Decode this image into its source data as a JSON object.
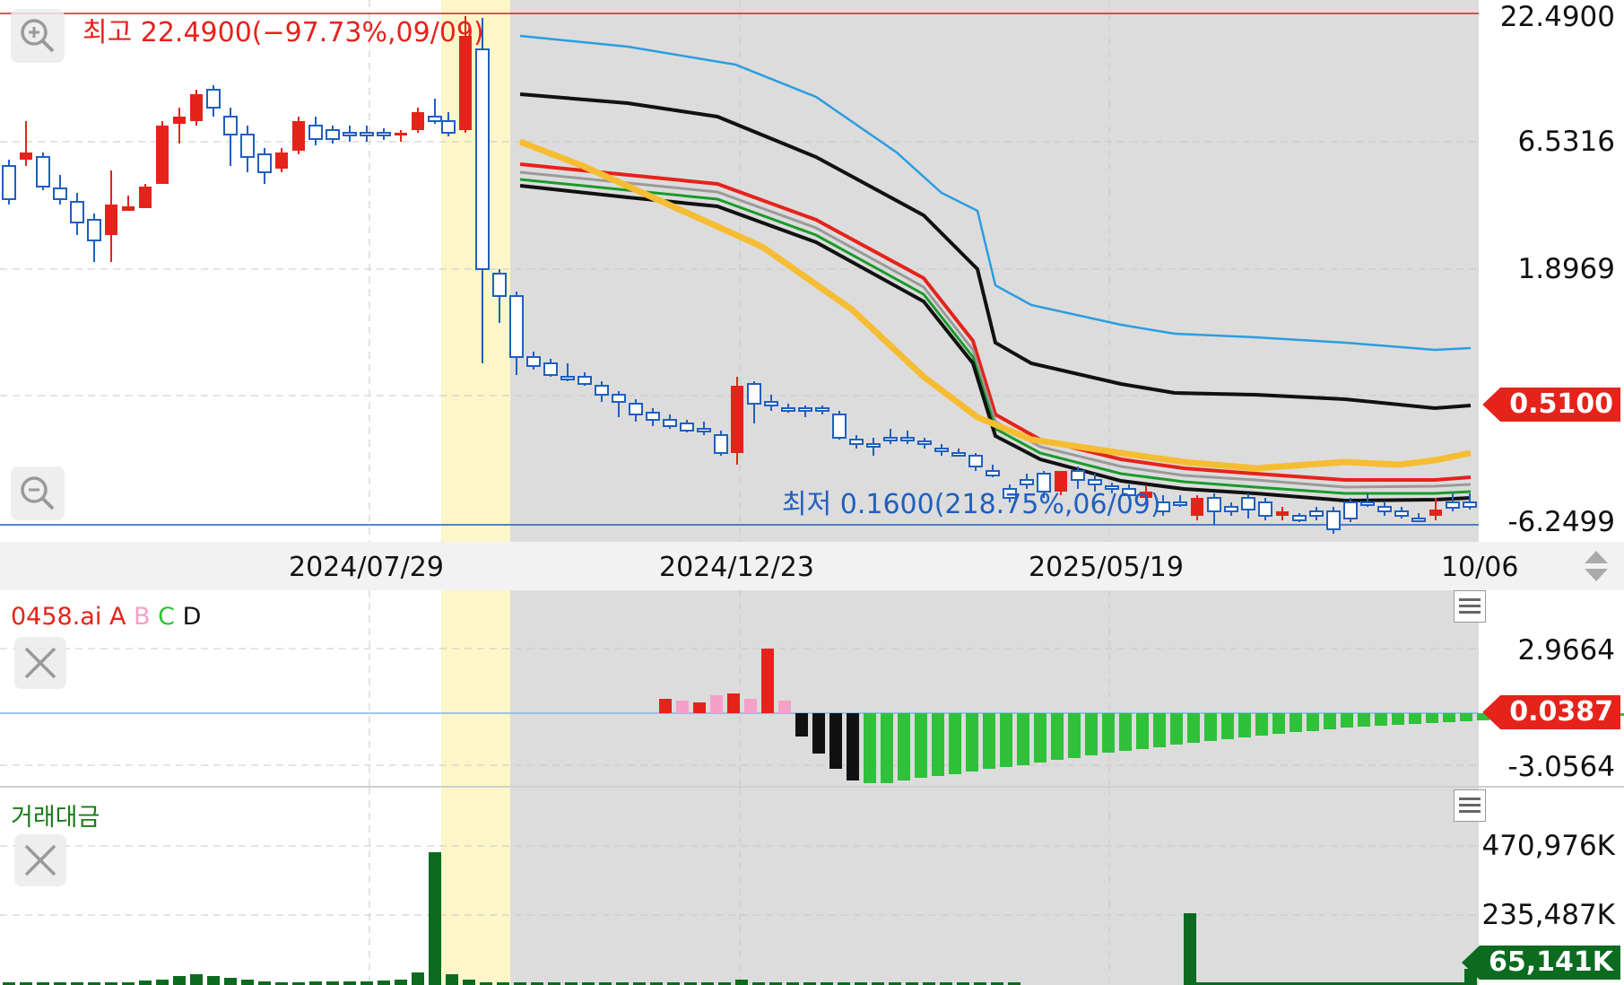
{
  "price_chart": {
    "high_label": "최고 22.4900(−97.73%,09/09)",
    "low_label": "최저 0.1600(218.75%,06/09)",
    "axis_labels": [
      "22.4900",
      "6.5316",
      "1.8969",
      "0.5100",
      "-6.2499"
    ],
    "current_price_badge": "0.5100"
  },
  "date_axis": {
    "labels": [
      "2024/07/29",
      "2024/12/23",
      "2025/05/19",
      "10/06"
    ]
  },
  "indicator_panel": {
    "title": "0458.ai",
    "legend": [
      {
        "key": "A",
        "color": "#e5231b"
      },
      {
        "key": "B",
        "color": "#f4a0c8"
      },
      {
        "key": "C",
        "color": "#2fc13a"
      },
      {
        "key": "D",
        "color": "#111111"
      }
    ],
    "axis_labels": [
      "2.9664",
      "-3.0564"
    ],
    "current_value_badge": "0.0387"
  },
  "volume_panel": {
    "title": "거래대금",
    "axis_labels": [
      "470,976K",
      "235,487K"
    ],
    "current_value_badge": "65,141K"
  },
  "icons": {
    "zoom_in": "zoom-in-icon",
    "zoom_out": "zoom-out-icon",
    "close": "close-icon",
    "menu": "menu-icon",
    "scroll": "scroll-updown-icon"
  },
  "colors": {
    "up": "#e5231b",
    "down": "#1f5fbf",
    "highlight": "#fdf6c8",
    "shade": "#dcdcdc",
    "volume": "#0b6b1f"
  }
}
